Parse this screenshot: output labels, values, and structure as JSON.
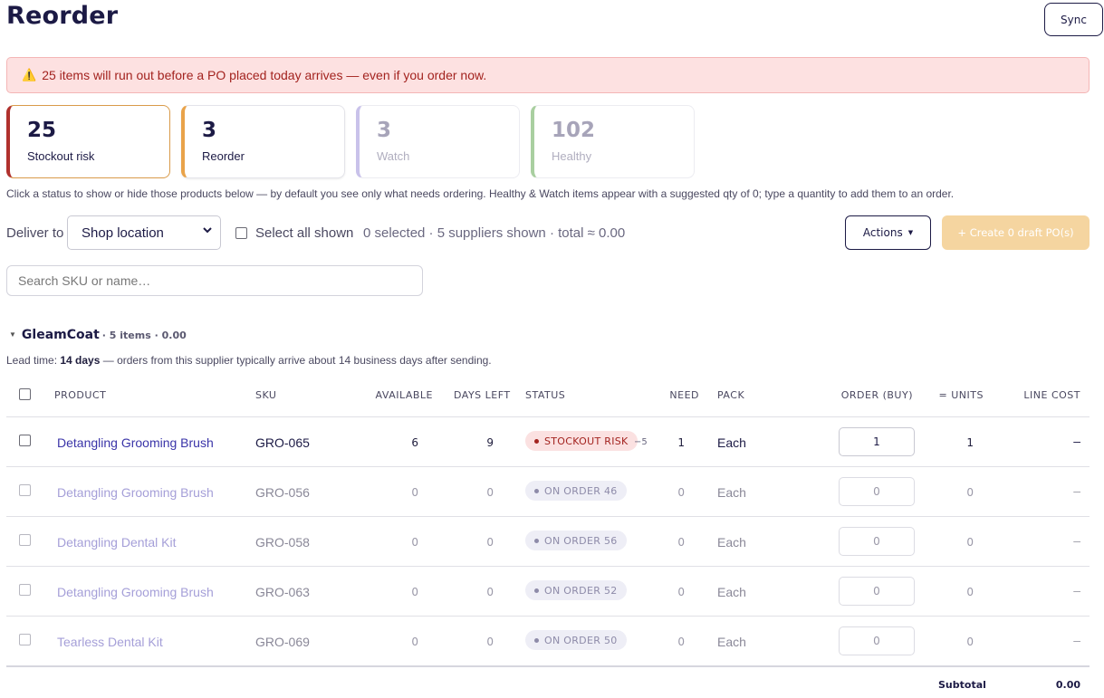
{
  "page": {
    "title": "Reorder",
    "sync_label": "Sync"
  },
  "alert": {
    "text": "25 items will run out before a PO placed today arrives — even if you order now."
  },
  "status_cards": [
    {
      "count": "25",
      "label": "Stockout risk",
      "color": "#b0312d"
    },
    {
      "count": "3",
      "label": "Reorder",
      "color": "#e9a34a"
    },
    {
      "count": "3",
      "label": "Watch",
      "color": "#c9c2ea"
    },
    {
      "count": "102",
      "label": "Healthy",
      "color": "#a9cfa0"
    }
  ],
  "hint": "Click a status to show or hide those products below — by default you see only what needs ordering. Healthy & Watch items appear with a suggested qty of 0; type a quantity to add them to an order.",
  "toolbar": {
    "deliver_label": "Deliver to",
    "deliver_value": "Shop location",
    "select_all_label": "Select all shown",
    "summary": "0 selected · 5 suppliers shown · total ≈ 0.00",
    "actions_label": "Actions",
    "create_label": "+ Create 0 draft PO(s)"
  },
  "search": {
    "placeholder": "Search SKU or name…"
  },
  "supplier": {
    "name": "GleamCoat",
    "meta": "· 5 items · 0.00",
    "lead_prefix": "Lead time: ",
    "lead_days": "14 days",
    "lead_suffix": " — orders from this supplier typically arrive about 14 business days after sending."
  },
  "table": {
    "headers": {
      "product": "PRODUCT",
      "sku": "SKU",
      "available": "AVAILABLE",
      "days_left": "DAYS LEFT",
      "status": "STATUS",
      "need": "NEED",
      "pack": "PACK",
      "order": "ORDER (BUY)",
      "units": "= UNITS",
      "line_cost": "LINE COST"
    },
    "rows": [
      {
        "product": "Detangling Grooming Brush",
        "sku": "GRO-065",
        "available": "6",
        "days_left": "9",
        "status": "STOCKOUT RISK",
        "delta": "−5",
        "need": "1",
        "pack": "Each",
        "order": "1",
        "units": "1",
        "line_cost": "–"
      },
      {
        "product": "Detangling Grooming Brush",
        "sku": "GRO-056",
        "available": "0",
        "days_left": "0",
        "status": "ON ORDER 46",
        "delta": "",
        "need": "0",
        "pack": "Each",
        "order": "0",
        "units": "0",
        "line_cost": "–"
      },
      {
        "product": "Detangling Dental Kit",
        "sku": "GRO-058",
        "available": "0",
        "days_left": "0",
        "status": "ON ORDER 56",
        "delta": "",
        "need": "0",
        "pack": "Each",
        "order": "0",
        "units": "0",
        "line_cost": "–"
      },
      {
        "product": "Detangling Grooming Brush",
        "sku": "GRO-063",
        "available": "0",
        "days_left": "0",
        "status": "ON ORDER 52",
        "delta": "",
        "need": "0",
        "pack": "Each",
        "order": "0",
        "units": "0",
        "line_cost": "–"
      },
      {
        "product": "Tearless Dental Kit",
        "sku": "GRO-069",
        "available": "0",
        "days_left": "0",
        "status": "ON ORDER 50",
        "delta": "",
        "need": "0",
        "pack": "Each",
        "order": "0",
        "units": "0",
        "line_cost": "–"
      }
    ],
    "subtotal_label": "Subtotal",
    "subtotal_value": "0.00"
  }
}
